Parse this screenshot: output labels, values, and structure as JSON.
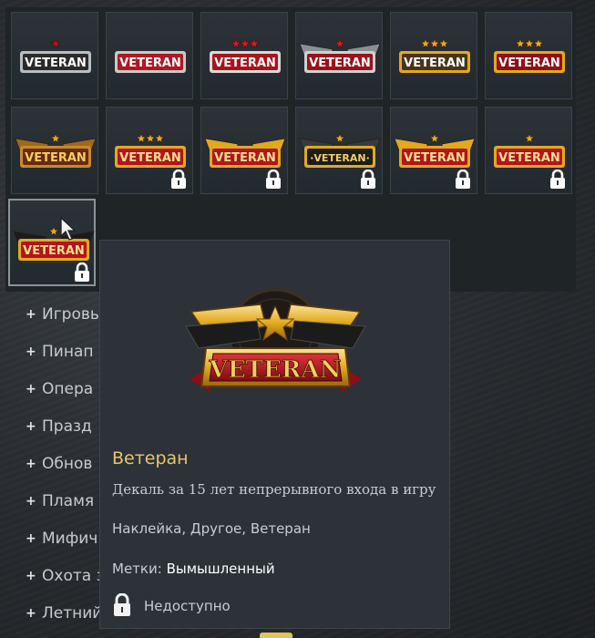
{
  "decal_grid": {
    "items": [
      {
        "label": "VETERAN",
        "locked": false,
        "style": "silver-plain"
      },
      {
        "label": "VETERAN",
        "locked": false,
        "style": "red-plain"
      },
      {
        "label": "VETERAN",
        "locked": false,
        "style": "red-stars"
      },
      {
        "label": "VETERAN",
        "locked": false,
        "style": "red-wings"
      },
      {
        "label": "VETERAN",
        "locked": false,
        "style": "gold-stars"
      },
      {
        "label": "VETERAN",
        "locked": false,
        "style": "gold-red"
      },
      {
        "label": "VETERAN",
        "locked": false,
        "style": "bronze-wings"
      },
      {
        "label": "VETERAN",
        "locked": true,
        "style": "gold-shield"
      },
      {
        "label": "VETERAN",
        "locked": true,
        "style": "gold-wings"
      },
      {
        "label": "·VETERAN·",
        "locked": true,
        "style": "dark-wings"
      },
      {
        "label": "VETERAN",
        "locked": true,
        "style": "gold-crest"
      },
      {
        "label": "VETERAN",
        "locked": true,
        "style": "gold-round"
      },
      {
        "label": "VETERAN",
        "locked": true,
        "style": "red-ribbon",
        "selected": true
      }
    ]
  },
  "category_menu": {
    "items": [
      {
        "label": "Игровы"
      },
      {
        "label": "Пинап"
      },
      {
        "label": "Опера"
      },
      {
        "label": "Празд"
      },
      {
        "label": "Обнов"
      },
      {
        "label": "Пламя"
      },
      {
        "label": "Мифич"
      },
      {
        "label": "Охота з"
      },
      {
        "label": "Летний"
      }
    ]
  },
  "tooltip": {
    "badge_text": "VETERAN",
    "title": "Ветеран",
    "description": "Декаль за 15 лет непрерывного входа в игру",
    "categories": "Наклейка, Другое, Ветеран",
    "tags_label": "Метки:",
    "tags_value": "Вымышленный",
    "status": "Недоступно"
  },
  "colors": {
    "title_gold": "#e9c46a",
    "panel_bg": "#2c3238",
    "badge_red": "#b3141e",
    "badge_gold": "#e2a91f"
  }
}
